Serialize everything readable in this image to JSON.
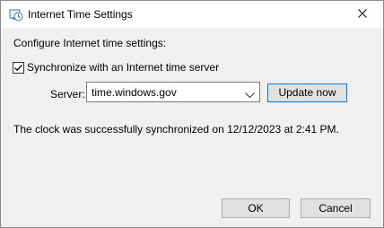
{
  "window": {
    "title": "Internet Time Settings",
    "title_icon": "clock-globe-icon",
    "close_icon": "close-icon"
  },
  "main": {
    "heading": "Configure Internet time settings:",
    "sync_checkbox": {
      "label": "Synchronize with an Internet time server",
      "checked": true
    },
    "server": {
      "label": "Server:",
      "value": "time.windows.gov"
    },
    "update_button": "Update now",
    "status": "The clock was successfully synchronized on 12/12/2023 at 2:41 PM."
  },
  "footer": {
    "ok_label": "OK",
    "cancel_label": "Cancel"
  },
  "colors": {
    "dialog_background": "#f0f0f0",
    "titlebar_background": "#ffffff",
    "focus_border": "#0078d7",
    "button_face": "#e1e1e1"
  }
}
